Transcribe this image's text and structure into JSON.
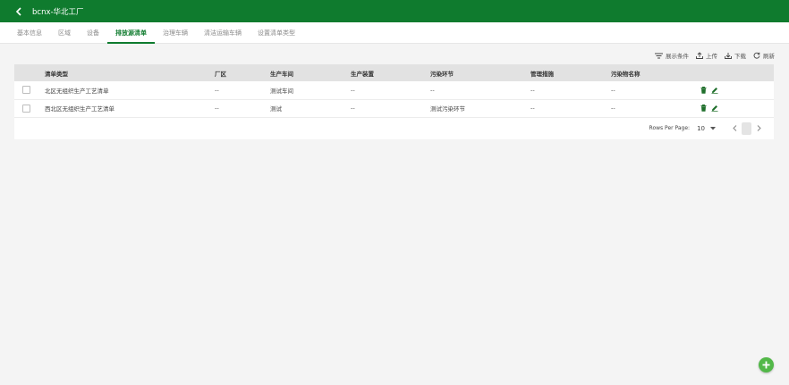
{
  "header": {
    "title": "bcnx-华北工厂"
  },
  "tabs": [
    {
      "label": "基本信息"
    },
    {
      "label": "区域"
    },
    {
      "label": "设备"
    },
    {
      "label": "排放源清单"
    },
    {
      "label": "治理车辆"
    },
    {
      "label": "清洁运输车辆"
    },
    {
      "label": "设置清单类型"
    }
  ],
  "active_tab": 3,
  "toolbar": {
    "filter_label": "展示条件",
    "upload_label": "上传",
    "download_label": "下载",
    "refresh_label": "刷新"
  },
  "table": {
    "columns": [
      "清单类型",
      "厂区",
      "生产车间",
      "生产装置",
      "污染环节",
      "管理措施",
      "污染物名称"
    ],
    "rows": [
      [
        "北区无组织生产工艺清单",
        "--",
        "测试车间",
        "--",
        "--",
        "--",
        "--"
      ],
      [
        "西北区无组织生产工艺清单",
        "--",
        "测试",
        "--",
        "测试污染环节",
        "--",
        "--"
      ]
    ]
  },
  "pagination": {
    "rows_per_page_label": "Rows Per Page:",
    "rows_per_page_value": "10"
  },
  "colors": {
    "brand": "#0f7b2e",
    "fab": "#52b848"
  }
}
